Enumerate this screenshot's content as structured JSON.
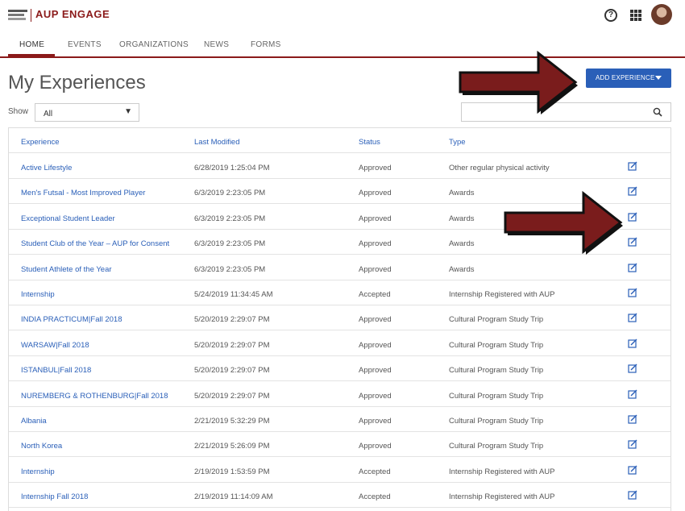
{
  "header": {
    "logo_text": "AUP ENGAGE"
  },
  "nav": {
    "tabs": [
      "HOME",
      "EVENTS",
      "ORGANIZATIONS",
      "NEWS",
      "FORMS"
    ],
    "active": "HOME"
  },
  "page": {
    "title": "My Experiences",
    "show_label": "Show",
    "show_value": "All",
    "add_button_label": "ADD EXPERIENCE",
    "search_placeholder": ""
  },
  "table": {
    "columns": [
      "Experience",
      "Last Modified",
      "Status",
      "Type"
    ],
    "rows": [
      [
        "Active Lifestyle",
        "6/28/2019 1:25:04 PM",
        "Approved",
        "Other regular physical activity"
      ],
      [
        "Men's Futsal - Most Improved Player",
        "6/3/2019 2:23:05 PM",
        "Approved",
        "Awards"
      ],
      [
        "Exceptional Student Leader",
        "6/3/2019 2:23:05 PM",
        "Approved",
        "Awards"
      ],
      [
        "Student Club of the Year – AUP for Consent",
        "6/3/2019 2:23:05 PM",
        "Approved",
        "Awards"
      ],
      [
        "Student Athlete of the Year",
        "6/3/2019 2:23:05 PM",
        "Approved",
        "Awards"
      ],
      [
        "Internship",
        "5/24/2019 11:34:45 AM",
        "Accepted",
        "Internship Registered with AUP"
      ],
      [
        "INDIA PRACTICUM|Fall 2018",
        "5/20/2019 2:29:07 PM",
        "Approved",
        "Cultural Program Study Trip"
      ],
      [
        "WARSAW|Fall 2018",
        "5/20/2019 2:29:07 PM",
        "Approved",
        "Cultural Program Study Trip"
      ],
      [
        "ISTANBUL|Fall 2018",
        "5/20/2019 2:29:07 PM",
        "Approved",
        "Cultural Program Study Trip"
      ],
      [
        "NUREMBERG & ROTHENBURG|Fall 2018",
        "5/20/2019 2:29:07 PM",
        "Approved",
        "Cultural Program Study Trip"
      ],
      [
        "Albania",
        "2/21/2019 5:32:29 PM",
        "Approved",
        "Cultural Program Study Trip"
      ],
      [
        "North Korea",
        "2/21/2019 5:26:09 PM",
        "Approved",
        "Cultural Program Study Trip"
      ],
      [
        "Internship",
        "2/19/2019 1:53:59 PM",
        "Accepted",
        "Internship Registered with AUP"
      ],
      [
        "Internship Fall 2018",
        "2/19/2019 11:14:09 AM",
        "Accepted",
        "Internship Registered with AUP"
      ]
    ]
  },
  "colors": {
    "brand": "#8b1a1a",
    "link": "#2a5fb8",
    "button": "#2a5fb8",
    "annotation_arrow": "#7a1c1c"
  },
  "icons": {
    "help": "help-circle-icon",
    "apps": "apps-grid-icon",
    "search": "search-icon",
    "edit": "edit-icon"
  }
}
